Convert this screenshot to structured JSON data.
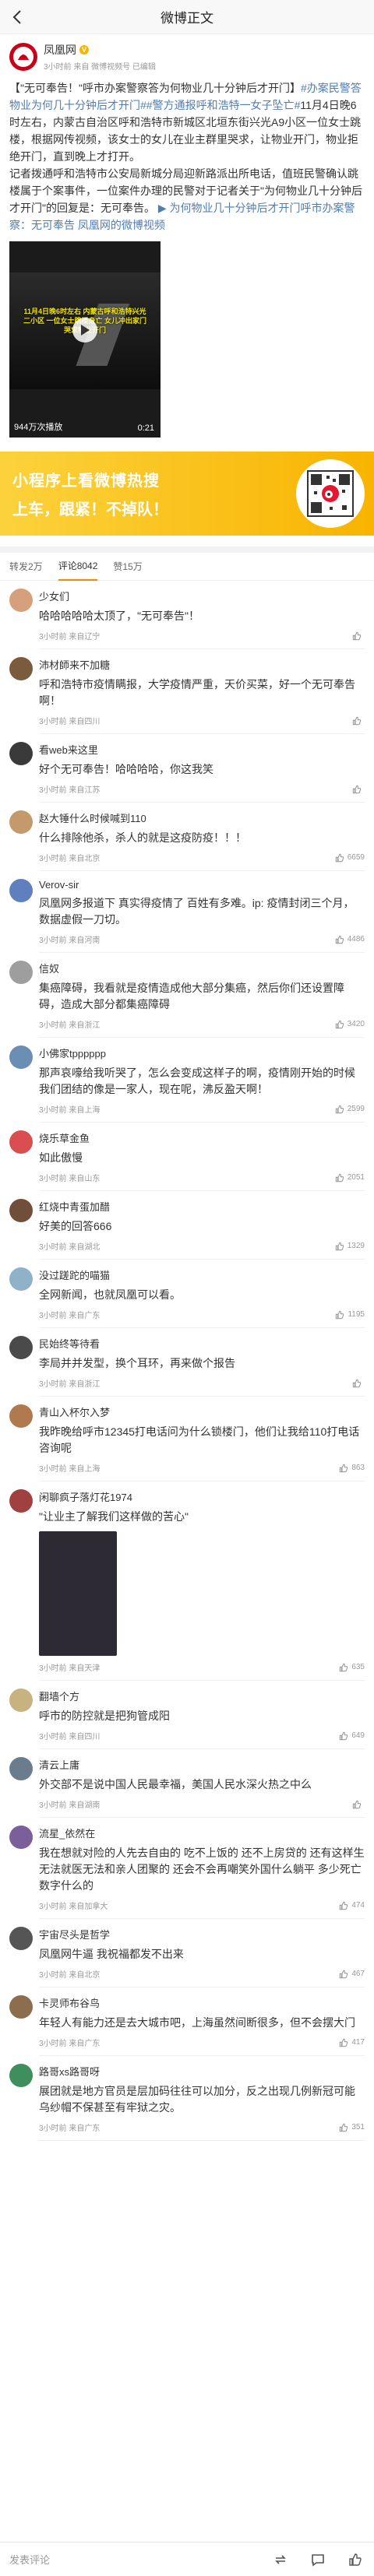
{
  "header": {
    "title": "微博正文"
  },
  "post": {
    "author": "凤凰网",
    "meta": "3小时前 来自 微博视频号 已编辑",
    "text_a": "【\"无可奉告！\"呼市办案警察答为何物业几十分钟后才开门】",
    "topic1": "#办案民警答物业为何几十分钟后才开门#",
    "topic2": "#警方通报呼和浩特一女子坠亡#",
    "text_b": "11月4日晚6时左右，内蒙古自治区呼和浩特市新城区北垣东街兴光A9小区一位女士跳楼，根据网传视频，该女士的女儿在业主群里哭求，让物业开门，物业拒绝开门，直到晚上才打开。",
    "text_c": "记者拨通呼和浩特市公安局新城分局迎新路派出所电话，值班民警确认跳楼属于个案事件，一位案件办理的民警对于记者关于\"为何物业几十分钟后才开门\"的回复是：无可奉告。",
    "link_video": "为何物业几十分钟后才开门",
    "link_label": "呼市办案警察：无可奉告",
    "link_source": "凤凰网的微博视频",
    "video_caption": "11月4日晚6时左右 内蒙古呼和浩特兴光二小区 一位女士跳楼身亡 女儿冲出家门 哭求物业开门",
    "views": "944万次播放",
    "duration": "0:21"
  },
  "banner": {
    "line1": "小程序上看微博热搜",
    "line2": "上车，跟紧！不掉队！"
  },
  "tabs": {
    "repost": "转发2万",
    "comment": "评论8042",
    "like": "赞15万"
  },
  "comments": [
    {
      "name": "少女们",
      "text": "哈哈哈哈哈太顶了，\"无可奉告\"！",
      "meta": "3小时前 来自辽宁",
      "likes": "",
      "color": "#d7a07c"
    },
    {
      "name": "沛材師来不加糖",
      "text": "呼和浩特市疫情瞒报，大学疫情严重，天价买菜，好一个无可奉告啊！",
      "meta": "3小时前 来自四川",
      "likes": "",
      "color": "#7a5b3e"
    },
    {
      "name": "看web来这里",
      "text": "好个无可奉告！哈哈哈哈，你这我笑",
      "meta": "3小时前 来自江苏",
      "likes": "",
      "color": "#3a3a3a"
    },
    {
      "name": "赵大锤什么时候喊到110",
      "text": "什么排除他杀，杀人的就是这疫防疫！！！",
      "meta": "3小时前 来自北京",
      "likes": "6659",
      "color": "#c49a6c"
    },
    {
      "name": "Verov-sir",
      "text": "凤凰网多报道下 真实得疫情了 百姓有多难。ip: 疫情封闭三个月，数据虚假一刀切。",
      "meta": "3小时前 来自河南",
      "likes": "4486",
      "color": "#5f7fbf"
    },
    {
      "name": "信奴",
      "text": "集癌障碍，我看就是疫情造成他大部分集癌，然后你们还设置障碍，造成大部分都集癌障碍",
      "meta": "3小时前 来自浙江",
      "likes": "3420",
      "color": "#9e9e9e"
    },
    {
      "name": "小佛家tpppppp",
      "text": "那声哀嚎给我听哭了，怎么会变成这样子的啊，疫情刚开始的时候我们团结的像是一家人，现在呢，沸反盈天啊！",
      "meta": "3小时前 来自上海",
      "likes": "2599",
      "color": "#6a8eb4"
    },
    {
      "name": "烧乐草金鱼",
      "text": "如此傲慢",
      "meta": "3小时前 来自山东",
      "likes": "2051",
      "color": "#d94f4f"
    },
    {
      "name": "红烧中青蛋加醋",
      "text": "好美的回答666",
      "meta": "3小时前 来自湖北",
      "likes": "1329",
      "color": "#704e3a"
    },
    {
      "name": "没过蹉跎的喵猫",
      "text": "全网新闻，也就凤凰可以看。",
      "meta": "3小时前 来自广东",
      "likes": "1195",
      "color": "#8fb2c9"
    },
    {
      "name": "民始终等待看",
      "text": "李局并并发型，换个耳环，再来做个报告",
      "meta": "3小时前 来自浙江",
      "likes": "",
      "color": "#4a4a4a"
    },
    {
      "name": "青山入杯尔入梦",
      "text": "我昨晚给呼市12345打电话问为什么锁楼门，他们让我给110打电话咨询呢",
      "meta": "3小时前 来自上海",
      "likes": "863",
      "color": "#b07a4c"
    },
    {
      "name": "闲聊疯子落灯花1974",
      "text": "\"让业主了解我们这样做的苦心\"",
      "meta": "3小时前 来自天津",
      "likes": "635",
      "color": "#a04040"
    },
    {
      "name": "翻墙个方",
      "text": "呼市的防控就是把狗管成阳",
      "meta": "3小时前 来自四川",
      "likes": "649",
      "color": "#c8b280"
    },
    {
      "name": "清云上庸",
      "text": "外交部不是说中国人民最幸福，美国人民水深火热之中么",
      "meta": "3小时前 来自湖南",
      "likes": "",
      "color": "#6b7d8c"
    },
    {
      "name": "流星_依然在",
      "text": "我在想就对险的人先去自由的 吃不上饭的 还不上房贷的 还有这样生无法就医无法和亲人团聚的 还会不会再嘲笑外国什么躺平 多少死亡数字什么的",
      "meta": "3小时前 来自加拿大",
      "likes": "474",
      "color": "#7a5f9a"
    },
    {
      "name": "宇宙尽头是哲学",
      "text": "凤凰网牛逼 我祝福都发不出来",
      "meta": "3小时前 来自北京",
      "likes": "467",
      "color": "#555555"
    },
    {
      "name": "卡灵师布谷鸟",
      "text": "年轻人有能力还是去大城市吧，上海虽然间断很多，但不会摆大门",
      "meta": "3小时前 来自广东",
      "likes": "417",
      "color": "#8c6e4e"
    },
    {
      "name": "路哥xs路哥呀",
      "text": "展团就是地方官员是层加码往往可以加分，反之出现几例新冠可能乌纱帽不保甚至有牢狱之灾。",
      "meta": "3小时前 来自广东",
      "likes": "351",
      "color": "#3e8e5e"
    }
  ],
  "bottom": {
    "placeholder": "发表评论"
  }
}
